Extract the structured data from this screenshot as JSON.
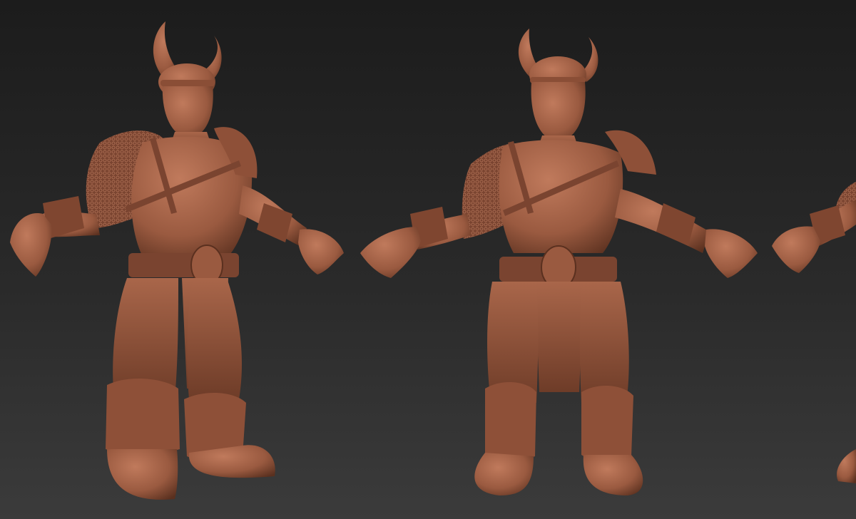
{
  "scene": {
    "background_top": "#1c1c1c",
    "background_mid": "#2a2a2a",
    "background_bottom": "#3b3b3b",
    "clay_color": "#9a5a40",
    "clay_highlight": "#c07a5c",
    "clay_shadow": "#5a301f",
    "figures": [
      {
        "view": "three-quarter"
      },
      {
        "view": "front"
      },
      {
        "view": "side-cropped"
      }
    ]
  }
}
